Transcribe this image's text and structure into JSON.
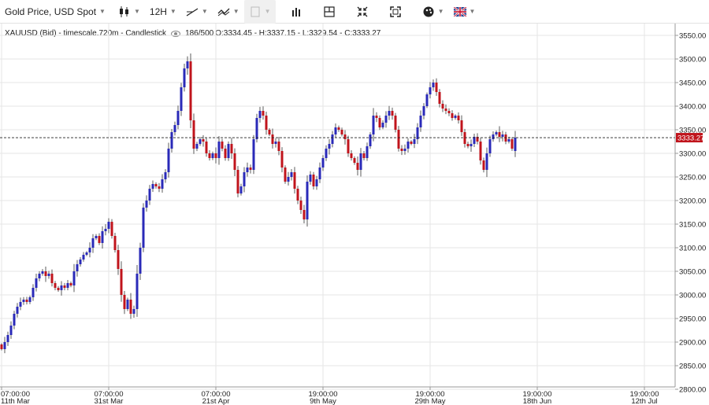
{
  "toolbar": {
    "instrument_label": "Gold Price, USD Spot",
    "interval_label": "12H"
  },
  "info": {
    "symbol_line": "XAUUSD (Bid) - timescale.720m - Candlestick",
    "bars_count": "186/500",
    "ohlc_line": "O:3334.45 - H:3337.15 - L:3329.54 - C:3333.27"
  },
  "colors": {
    "up": "#2a2ab8",
    "down": "#c0141c",
    "wick": "#333333",
    "grid": "#e6e6e6",
    "price_tag": "#c0141c"
  },
  "chart_data": {
    "type": "candlestick",
    "title": "Gold Price, USD Spot",
    "ylim": [
      2780,
      3570
    ],
    "yticks": [
      2800,
      2850,
      2900,
      2950,
      3000,
      3050,
      3100,
      3150,
      3200,
      3250,
      3300,
      3350,
      3400,
      3450,
      3500,
      3550
    ],
    "ytick_labels": [
      "2800.00",
      "2850.00",
      "2900.00",
      "2950.00",
      "3000.00",
      "3050.00",
      "3100.00",
      "3150.00",
      "3200.00",
      "3250.00",
      "3300.00",
      "3350.00",
      "3400.00",
      "3450.00",
      "3500.00",
      "3550.00"
    ],
    "last_price": 3333.27,
    "last_price_label": "3333.27",
    "xaxis": [
      {
        "time": "07:00:00",
        "date": "11th Mar",
        "bar": 0
      },
      {
        "time": "07:00:00",
        "date": "31st Mar",
        "bar": 34
      },
      {
        "time": "07:00:00",
        "date": "21st Apr",
        "bar": 68
      },
      {
        "time": "19:00:00",
        "date": "9th May",
        "bar": 102
      },
      {
        "time": "19:00:00",
        "date": "29th May",
        "bar": 136
      },
      {
        "time": "19:00:00",
        "date": "18th Jun",
        "bar": 170
      },
      {
        "time": "19:00:00",
        "date": "12th Jul",
        "bar": 204
      }
    ],
    "closes": [
      2885,
      2900,
      2915,
      2935,
      2960,
      2975,
      2985,
      2990,
      2985,
      2995,
      3015,
      3035,
      3045,
      3050,
      3040,
      3045,
      3025,
      3015,
      3010,
      3020,
      3015,
      3025,
      3020,
      3050,
      3065,
      3075,
      3085,
      3090,
      3100,
      3120,
      3125,
      3110,
      3135,
      3140,
      3155,
      3125,
      3095,
      3055,
      3000,
      2970,
      2990,
      2960,
      2970,
      3045,
      3100,
      3185,
      3200,
      3225,
      3235,
      3230,
      3225,
      3245,
      3260,
      3310,
      3345,
      3360,
      3390,
      3440,
      3480,
      3495,
      3370,
      3310,
      3320,
      3330,
      3325,
      3300,
      3290,
      3300,
      3290,
      3325,
      3310,
      3290,
      3320,
      3300,
      3265,
      3215,
      3230,
      3260,
      3270,
      3265,
      3330,
      3375,
      3390,
      3380,
      3350,
      3340,
      3320,
      3325,
      3305,
      3270,
      3240,
      3250,
      3260,
      3225,
      3200,
      3180,
      3160,
      3240,
      3255,
      3230,
      3245,
      3270,
      3290,
      3310,
      3320,
      3340,
      3355,
      3350,
      3340,
      3330,
      3300,
      3290,
      3280,
      3265,
      3300,
      3290,
      3315,
      3340,
      3380,
      3375,
      3355,
      3365,
      3380,
      3390,
      3380,
      3350,
      3310,
      3305,
      3310,
      3325,
      3320,
      3330,
      3355,
      3380,
      3400,
      3425,
      3440,
      3450,
      3430,
      3405,
      3395,
      3390,
      3385,
      3375,
      3380,
      3370,
      3345,
      3320,
      3315,
      3320,
      3335,
      3325,
      3285,
      3265,
      3300,
      3330,
      3340,
      3345,
      3335,
      3340,
      3325,
      3330,
      3310,
      3333.27
    ],
    "ohlc_last": {
      "open": 3334.45,
      "high": 3337.15,
      "low": 3329.54,
      "close": 3333.27
    }
  }
}
